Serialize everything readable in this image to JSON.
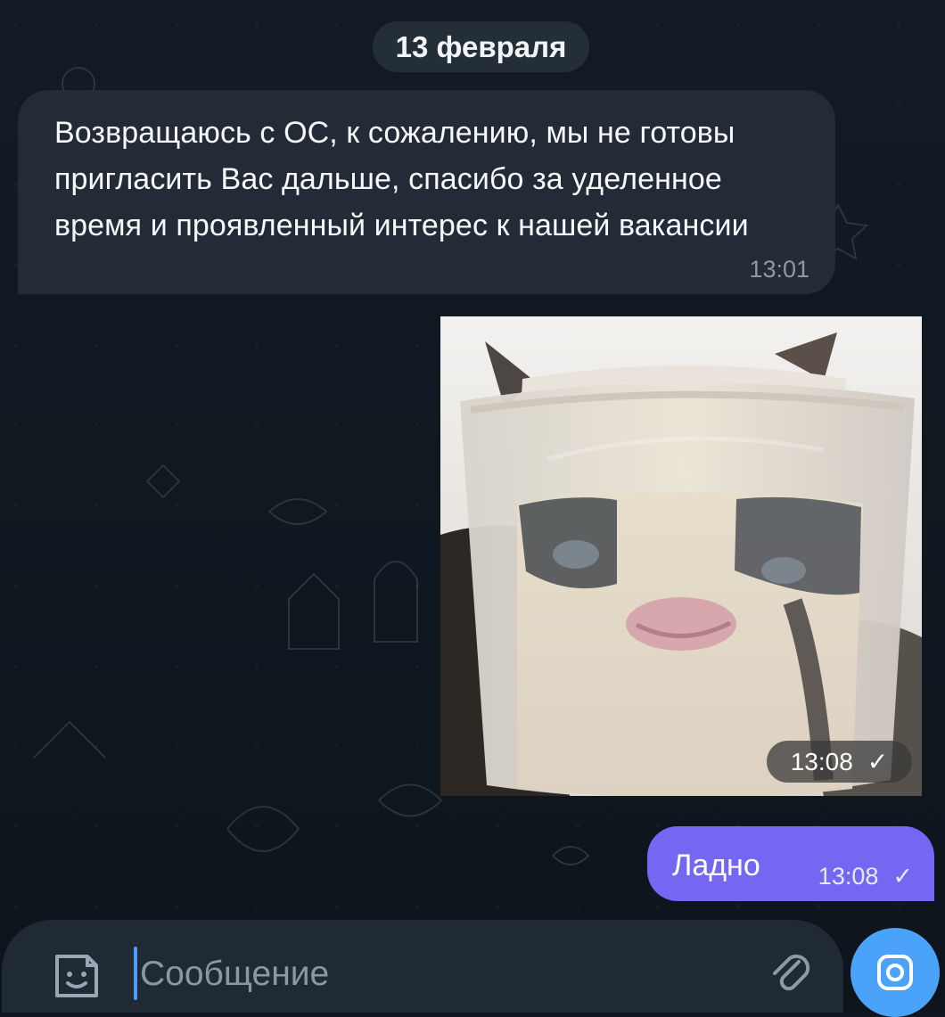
{
  "date_separator": "13 февраля",
  "messages": {
    "incoming": {
      "text": "Возвращаюсь с ОС, к сожалению, мы не готовы пригласить Вас дальше, спасибо за уделенное время и проявленный интерес к нашей вакансии",
      "time": "13:01"
    },
    "image": {
      "time": "13:08",
      "status": "✓"
    },
    "outgoing": {
      "text": "Ладно",
      "time": "13:08",
      "status": "✓"
    }
  },
  "composer": {
    "placeholder": "Сообщение"
  },
  "colors": {
    "outgoing_bubble": "#7468f2",
    "incoming_bubble": "#222b36",
    "camera_button": "#4aa3f8",
    "background": "#0f1720"
  },
  "icons": {
    "sticker": "sticker-icon",
    "attach": "paperclip-icon",
    "camera": "camera-icon"
  }
}
